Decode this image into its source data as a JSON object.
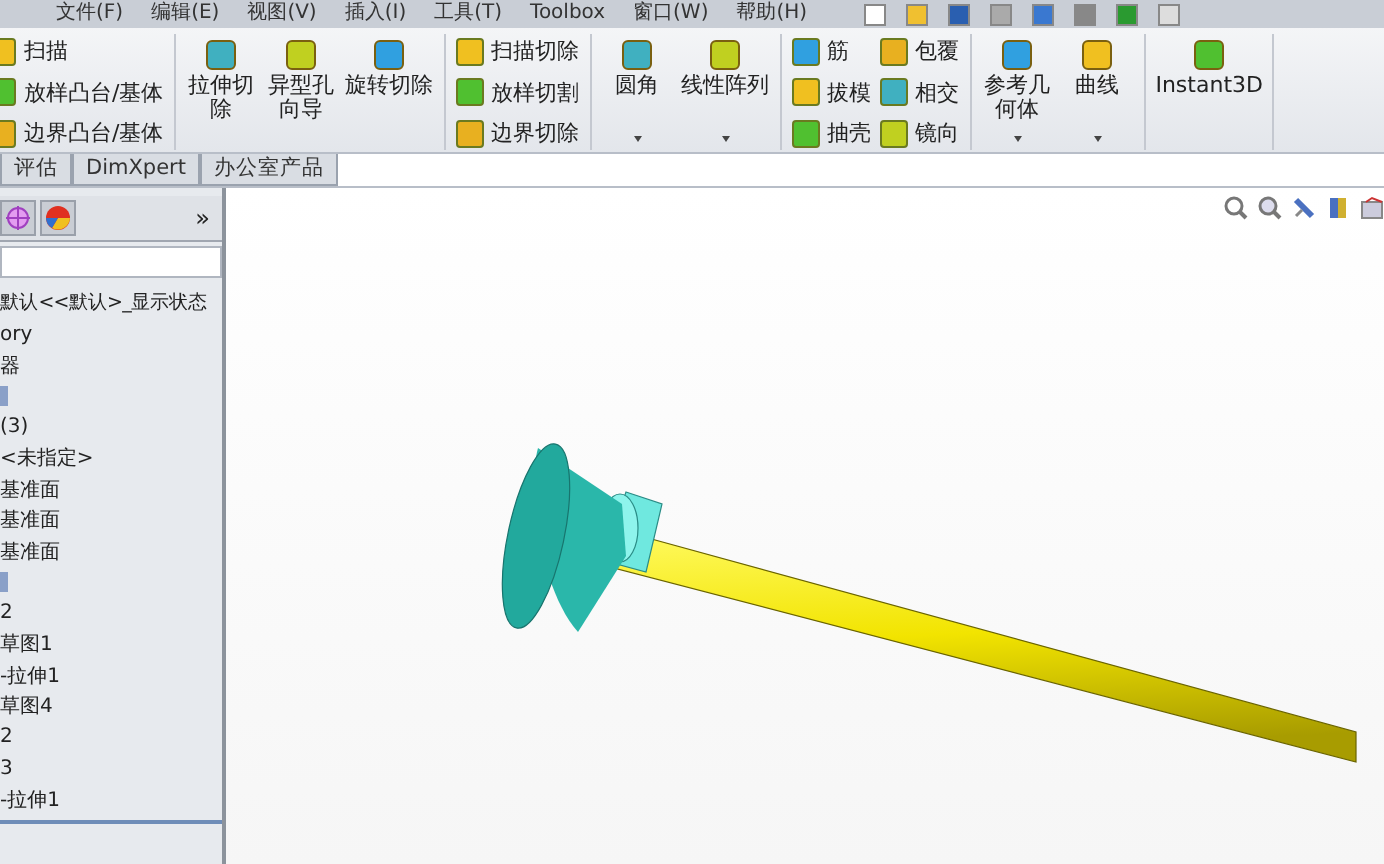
{
  "menu_bar": [
    "文件(F)",
    "编辑(E)",
    "视图(V)",
    "插入(I)",
    "工具(T)",
    "Toolbox",
    "窗口(W)",
    "帮助(H)"
  ],
  "ribbon": {
    "groups": [
      {
        "kind": "list",
        "columns": [
          [
            "扫描",
            "放样凸台/基体",
            "边界凸台/基体"
          ]
        ]
      },
      {
        "kind": "big",
        "buttons": [
          {
            "label": "拉伸切除",
            "dropdown": false
          },
          {
            "label": "异型孔向导",
            "dropdown": false
          },
          {
            "label": "旋转切除",
            "dropdown": false
          }
        ]
      },
      {
        "kind": "list",
        "columns": [
          [
            "扫描切除",
            "放样切割",
            "边界切除"
          ]
        ]
      },
      {
        "kind": "big",
        "buttons": [
          {
            "label": "圆角",
            "dropdown": true
          },
          {
            "label": "线性阵列",
            "dropdown": true
          }
        ]
      },
      {
        "kind": "list",
        "columns": [
          [
            "筋",
            "拔模",
            "抽壳"
          ],
          [
            "包覆",
            "相交",
            "镜向"
          ]
        ]
      },
      {
        "kind": "big",
        "buttons": [
          {
            "label": "参考几何体",
            "dropdown": true
          },
          {
            "label": "曲线",
            "dropdown": true
          }
        ]
      },
      {
        "kind": "big",
        "buttons": [
          {
            "label": "Instant3D",
            "dropdown": false
          }
        ]
      }
    ]
  },
  "tabs": [
    {
      "label": "评估",
      "selected": false
    },
    {
      "label": "DimXpert",
      "selected": false
    },
    {
      "label": "办公室产品",
      "selected": false
    }
  ],
  "panel": {
    "more": "»",
    "tree": [
      {
        "kind": "text",
        "text": "默认<<默认>_显示状态"
      },
      {
        "kind": "text",
        "text": "ory"
      },
      {
        "kind": "text",
        "text": "器"
      },
      {
        "kind": "icon"
      },
      {
        "kind": "text",
        "text": "(3)"
      },
      {
        "kind": "text",
        "text": "<未指定>"
      },
      {
        "kind": "text",
        "text": "基准面"
      },
      {
        "kind": "text",
        "text": "基准面"
      },
      {
        "kind": "text",
        "text": "基准面"
      },
      {
        "kind": "icon"
      },
      {
        "kind": "text",
        "text": "2"
      },
      {
        "kind": "text",
        "text": "草图1"
      },
      {
        "kind": "text",
        "text": "-拉伸1"
      },
      {
        "kind": "text",
        "text": "草图4"
      },
      {
        "kind": "text",
        "text": "2"
      },
      {
        "kind": "text",
        "text": "3"
      },
      {
        "kind": "text",
        "text": "-拉伸1"
      }
    ]
  }
}
